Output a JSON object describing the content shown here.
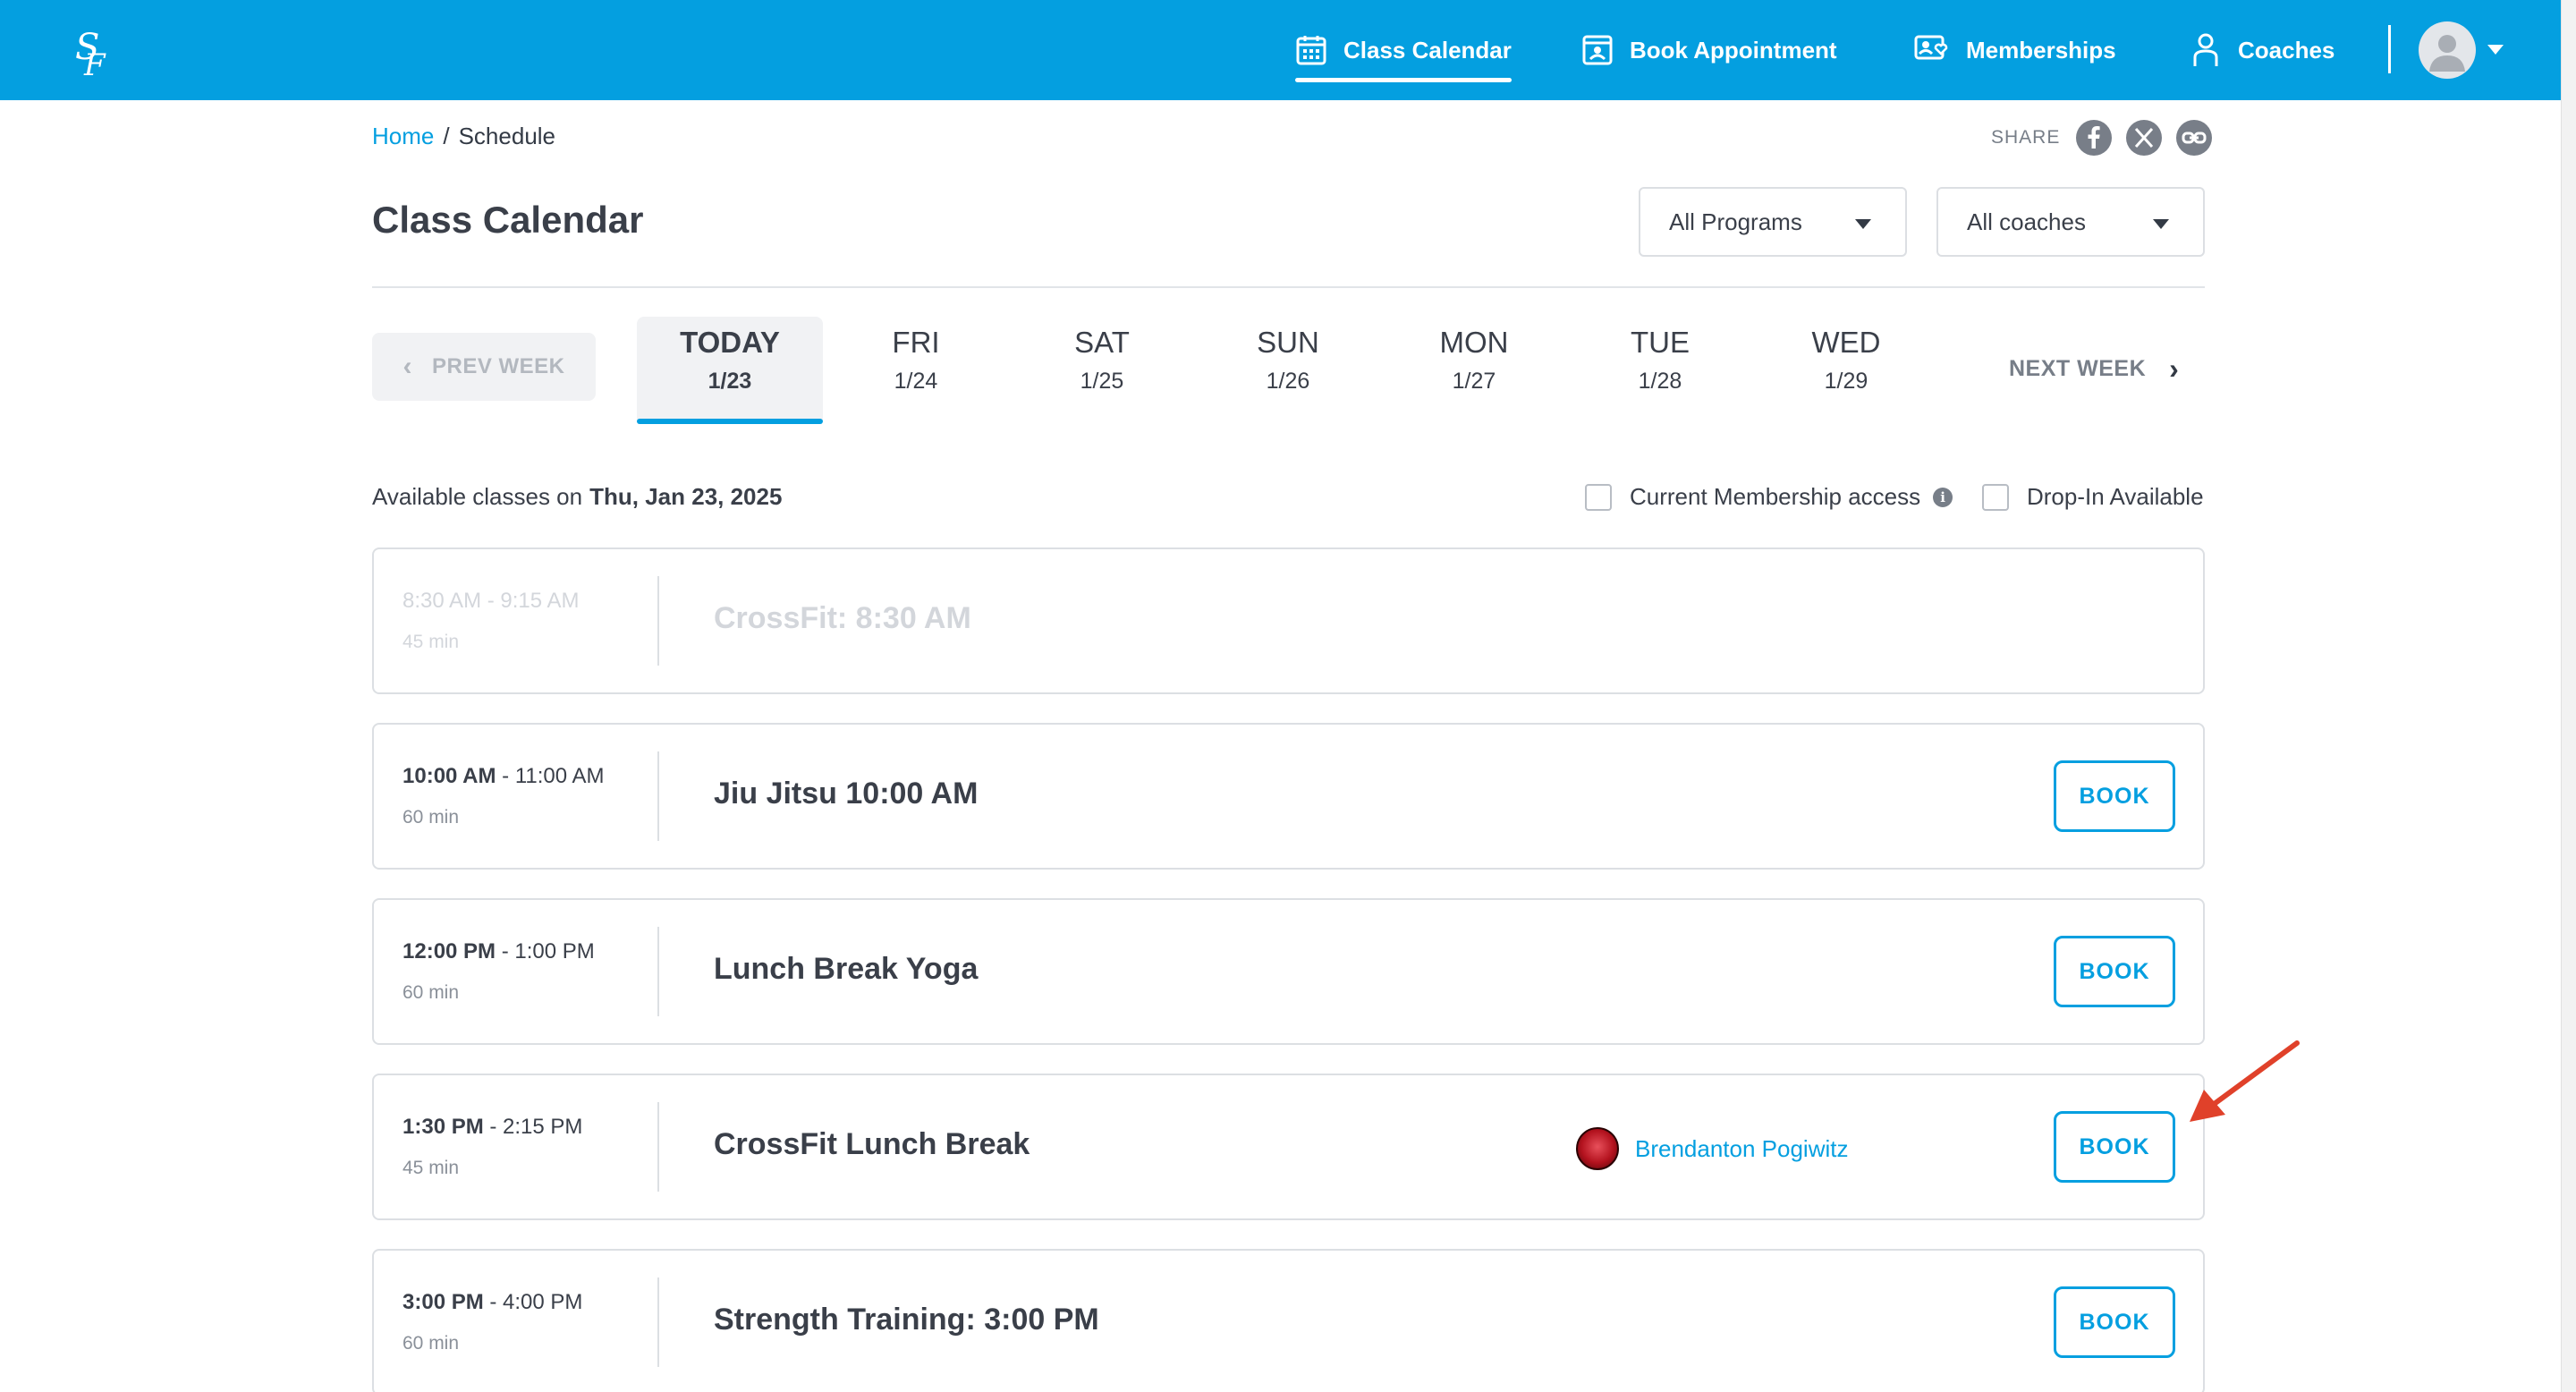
{
  "nav": {
    "items": [
      {
        "label": "Class Calendar",
        "icon": "calendar-icon",
        "active": true
      },
      {
        "label": "Book Appointment",
        "icon": "appointment-icon"
      },
      {
        "label": "Memberships",
        "icon": "membership-icon"
      },
      {
        "label": "Coaches",
        "icon": "person-icon"
      }
    ],
    "logo_text": "SF"
  },
  "breadcrumb": {
    "home": "Home",
    "separator": "/",
    "current": "Schedule"
  },
  "share": {
    "label": "SHARE",
    "icons": [
      "facebook-icon",
      "x-icon",
      "link-icon"
    ]
  },
  "page_title": "Class Calendar",
  "filters": {
    "programs": "All Programs",
    "coaches": "All coaches"
  },
  "week": {
    "prev_label": "PREV WEEK",
    "next_label": "NEXT WEEK",
    "days": [
      {
        "name": "TODAY",
        "date": "1/23",
        "active": true
      },
      {
        "name": "FRI",
        "date": "1/24"
      },
      {
        "name": "SAT",
        "date": "1/25"
      },
      {
        "name": "SUN",
        "date": "1/26"
      },
      {
        "name": "MON",
        "date": "1/27"
      },
      {
        "name": "TUE",
        "date": "1/28"
      },
      {
        "name": "WED",
        "date": "1/29"
      }
    ]
  },
  "available": {
    "prefix": "Available classes on",
    "date": "Thu, Jan 23, 2025"
  },
  "checkboxes": {
    "membership": "Current Membership access",
    "dropin": "Drop-In Available"
  },
  "classes": [
    {
      "start": "8:30 AM",
      "end": "- 9:15 AM",
      "duration": "45 min",
      "name": "CrossFit: 8:30 AM",
      "past": true
    },
    {
      "start": "10:00 AM",
      "end": "- 11:00 AM",
      "duration": "60 min",
      "name": "Jiu Jitsu 10:00 AM",
      "book": "BOOK"
    },
    {
      "start": "12:00 PM",
      "end": "- 1:00 PM",
      "duration": "60 min",
      "name": "Lunch Break Yoga",
      "book": "BOOK"
    },
    {
      "start": "1:30 PM",
      "end": "- 2:15 PM",
      "duration": "45 min",
      "name": "CrossFit Lunch Break",
      "book": "BOOK",
      "coach": "Brendanton Pogiwitz"
    },
    {
      "start": "3:00 PM",
      "end": "- 4:00 PM",
      "duration": "60 min",
      "name": "Strength Training: 3:00 PM",
      "book": "BOOK"
    }
  ],
  "colors": {
    "brand": "#049fe0",
    "annotation_arrow": "#e0412a"
  }
}
